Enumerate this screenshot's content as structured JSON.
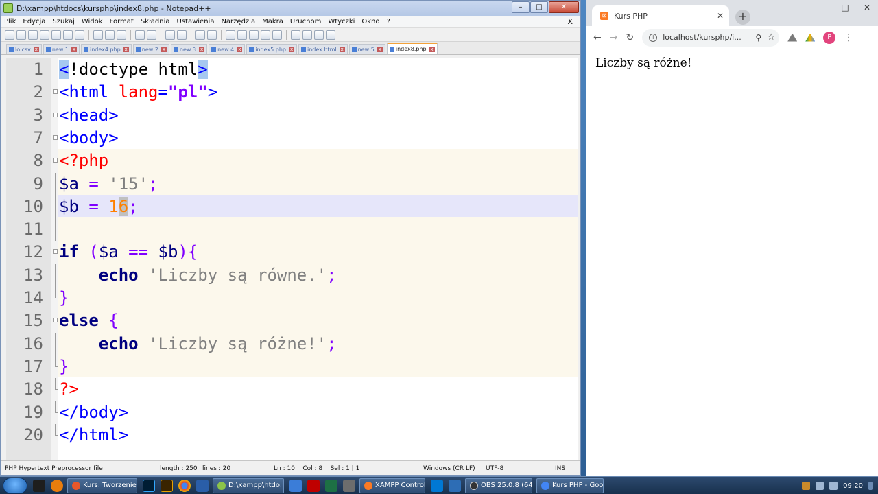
{
  "notepad": {
    "title": "D:\\xampp\\htdocs\\kursphp\\index8.php - Notepad++",
    "menu": [
      "Plik",
      "Edycja",
      "Szukaj",
      "Widok",
      "Format",
      "Składnia",
      "Ustawienia",
      "Narzędzia",
      "Makra",
      "Uruchom",
      "Wtyczki",
      "Okno",
      "?"
    ],
    "menu_close": "X",
    "tabs": [
      "lo.csv",
      "new 1",
      "index4.php",
      "new 2",
      "new 3",
      "new 4",
      "index5.php",
      "index.html",
      "new 5",
      "index8.php"
    ],
    "active_tab": "index8.php",
    "lines": [
      {
        "n": "1",
        "tokens": [
          {
            "t": "<",
            "c": "tag hl-blue"
          },
          {
            "t": "!doctype html",
            "c": "doc"
          },
          {
            "t": ">",
            "c": "tag hl-blue"
          }
        ]
      },
      {
        "n": "2",
        "tokens": [
          {
            "t": "<html ",
            "c": "tag"
          },
          {
            "t": "lang",
            "c": "attr"
          },
          {
            "t": "=",
            "c": "tag"
          },
          {
            "t": "\"pl\"",
            "c": "str"
          },
          {
            "t": ">",
            "c": "tag"
          }
        ]
      },
      {
        "n": "3",
        "tokens": [
          {
            "t": "<head>",
            "c": "tag"
          }
        ]
      },
      {
        "n": "7",
        "tokens": [
          {
            "t": "<body>",
            "c": "tag"
          }
        ]
      },
      {
        "n": "8",
        "tokens": [
          {
            "t": "<?php",
            "c": "php"
          }
        ]
      },
      {
        "n": "9",
        "tokens": [
          {
            "t": "$a",
            "c": "var"
          },
          {
            "t": " = ",
            "c": "op"
          },
          {
            "t": "'15'",
            "c": "pstr"
          },
          {
            "t": ";",
            "c": "op"
          }
        ]
      },
      {
        "n": "10",
        "tokens": [
          {
            "t": "$b",
            "c": "var"
          },
          {
            "t": " = ",
            "c": "op"
          },
          {
            "t": "1",
            "c": "num"
          },
          {
            "t": "6",
            "c": "num hl"
          },
          {
            "t": ";",
            "c": "op"
          }
        ]
      },
      {
        "n": "11",
        "tokens": []
      },
      {
        "n": "12",
        "tokens": [
          {
            "t": "if",
            "c": "kw"
          },
          {
            "t": " (",
            "c": "op"
          },
          {
            "t": "$a",
            "c": "var"
          },
          {
            "t": " == ",
            "c": "op"
          },
          {
            "t": "$b",
            "c": "var"
          },
          {
            "t": "){",
            "c": "op"
          }
        ]
      },
      {
        "n": "13",
        "tokens": [
          {
            "t": "    ",
            "c": "op"
          },
          {
            "t": "echo",
            "c": "kw"
          },
          {
            "t": " ",
            "c": "op"
          },
          {
            "t": "'Liczby są równe.'",
            "c": "pstr"
          },
          {
            "t": ";",
            "c": "op"
          }
        ]
      },
      {
        "n": "14",
        "tokens": [
          {
            "t": "}",
            "c": "op"
          }
        ]
      },
      {
        "n": "15",
        "tokens": [
          {
            "t": "else",
            "c": "kw"
          },
          {
            "t": " {",
            "c": "op"
          }
        ]
      },
      {
        "n": "16",
        "tokens": [
          {
            "t": "    ",
            "c": "op"
          },
          {
            "t": "echo",
            "c": "kw"
          },
          {
            "t": " ",
            "c": "op"
          },
          {
            "t": "'Liczby są różne!'",
            "c": "pstr"
          },
          {
            "t": ";",
            "c": "op"
          }
        ]
      },
      {
        "n": "17",
        "tokens": [
          {
            "t": "}",
            "c": "op"
          }
        ]
      },
      {
        "n": "18",
        "tokens": [
          {
            "t": "?>",
            "c": "php"
          }
        ]
      },
      {
        "n": "19",
        "tokens": [
          {
            "t": "</body>",
            "c": "tag"
          }
        ]
      },
      {
        "n": "20",
        "tokens": [
          {
            "t": "</html>",
            "c": "tag"
          }
        ]
      }
    ],
    "status": {
      "file_type": "PHP Hypertext Preprocessor file",
      "length": "length : 250",
      "lines": "lines : 20",
      "position": "Ln : 10    Col : 8    Sel : 1 | 1",
      "eol": "Windows (CR LF)",
      "encoding": "UTF-8",
      "mode": "INS"
    }
  },
  "chrome": {
    "tab_title": "Kurs PHP",
    "url": "localhost/kursphp/i...",
    "avatar_letter": "P",
    "page_text": "Liczby są różne!"
  },
  "taskbar": {
    "tasks": [
      {
        "label": "Kurs: Tworzenie ...",
        "color": "#e8572a"
      },
      {
        "label": "D:\\xampp\\htdo...",
        "color": "#8bc34a"
      },
      {
        "label": "XAMPP Control ...",
        "color": "#fb7a24"
      },
      {
        "label": "OBS 25.0.8 (64-...",
        "color": "#333333"
      },
      {
        "label": "Kurs PHP - Goo...",
        "color": "#4285f4"
      }
    ],
    "time": "09:20"
  },
  "colors": {
    "tag": "#0000ff",
    "php_delim": "#ff0000",
    "keyword": "#000080",
    "string": "#808080",
    "number": "#ff8000",
    "operator": "#8000ff"
  }
}
